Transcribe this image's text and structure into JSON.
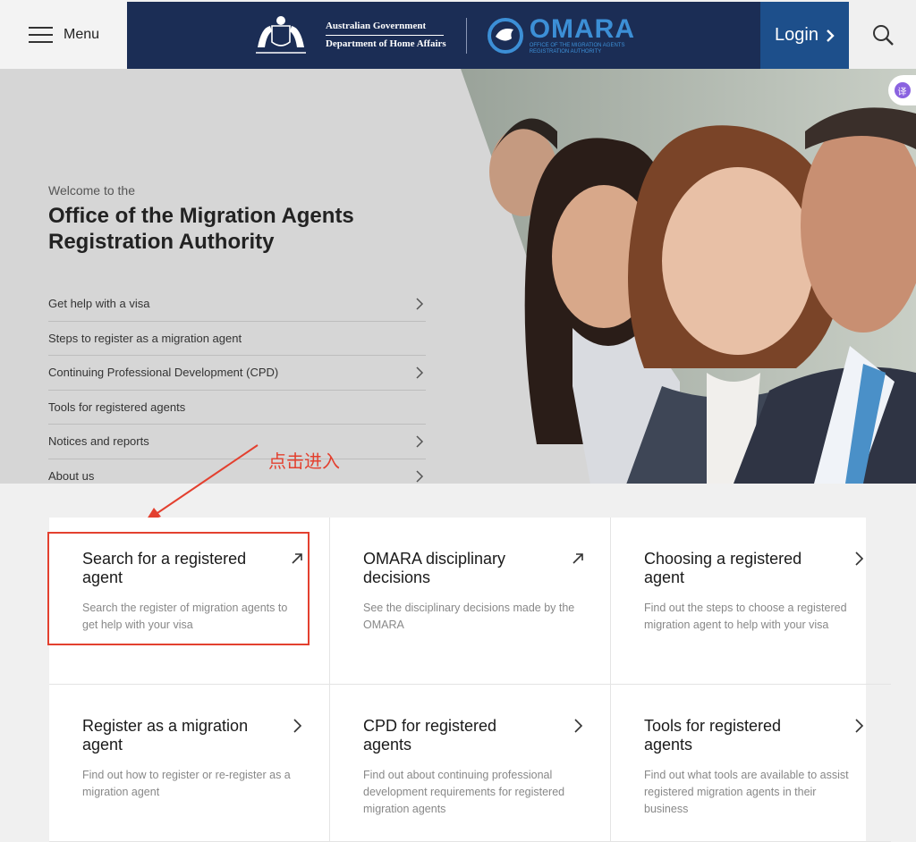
{
  "header": {
    "menu_label": "Menu",
    "gov_line1": "Australian Government",
    "gov_line2": "Department of Home Affairs",
    "brand_name": "OMARA",
    "brand_sub1": "OFFICE OF THE MIGRATION AGENTS",
    "brand_sub2": "REGISTRATION AUTHORITY",
    "login_label": "Login",
    "colors": {
      "banner": "#1b2d55",
      "login": "#1d4f8b",
      "brand": "#3c8fd6"
    }
  },
  "hero": {
    "welcome": "Welcome to the",
    "title": "Office of the Migration Agents Registration Authority",
    "links": [
      {
        "label": "Get help with a visa",
        "icon": "chevron-right-icon"
      },
      {
        "label": "Steps to register as a migration agent",
        "icon": ""
      },
      {
        "label": "Continuing Professional Development (CPD)",
        "icon": "chevron-right-icon"
      },
      {
        "label": "Tools for registered agents",
        "icon": ""
      },
      {
        "label": "Notices and reports",
        "icon": "chevron-right-icon"
      },
      {
        "label": "About us",
        "icon": "chevron-right-icon"
      }
    ]
  },
  "translate_badge": "译",
  "annotation": {
    "text": "点击进入",
    "color": "#e3402f"
  },
  "cards": [
    {
      "title": "Search for a registered agent",
      "desc": "Search the register of migration agents to get help with your visa",
      "icon": "external-arrow-icon"
    },
    {
      "title": "OMARA disciplinary decisions",
      "desc": "See the disciplinary decisions made by the OMARA",
      "icon": "external-arrow-icon"
    },
    {
      "title": "Choosing a registered agent",
      "desc": "Find out the steps to choose a registered migration agent to help with your visa",
      "icon": "chevron-right-icon"
    },
    {
      "title": "Register as a migration agent",
      "desc": "Find out how to register or re-register as a migration agent",
      "icon": "chevron-right-icon"
    },
    {
      "title": "CPD for registered agents",
      "desc": "Find out about continuing professional development requirements for registered migration agents",
      "icon": "chevron-right-icon"
    },
    {
      "title": "Tools for registered agents",
      "desc": "Find out what tools are available to assist registered migration agents in their business",
      "icon": "chevron-right-icon"
    }
  ]
}
